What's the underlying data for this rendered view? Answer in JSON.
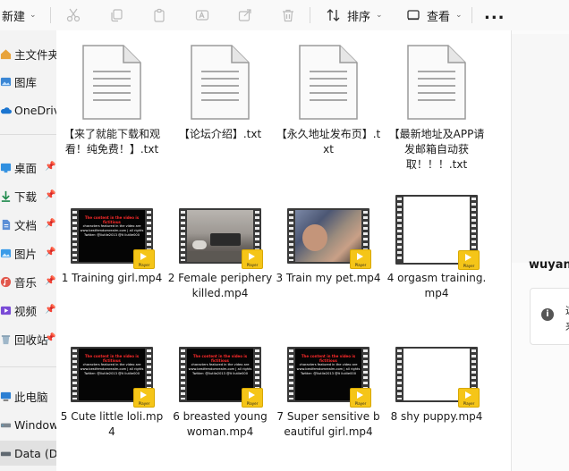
{
  "toolbar": {
    "new_label": "新建",
    "sort_label": "排序",
    "view_label": "查看",
    "more_label": "..."
  },
  "sidebar": {
    "items": [
      {
        "label": "主文件夹",
        "icon": "home-icon"
      },
      {
        "label": "图库",
        "icon": "gallery-icon"
      },
      {
        "label": "OneDrive",
        "icon": "cloud-icon"
      },
      {
        "label": "桌面",
        "icon": "desktop-icon"
      },
      {
        "label": "下载",
        "icon": "download-icon"
      },
      {
        "label": "文档",
        "icon": "document-icon"
      },
      {
        "label": "图片",
        "icon": "picture-icon"
      },
      {
        "label": "音乐",
        "icon": "music-icon"
      },
      {
        "label": "视频",
        "icon": "video-icon"
      },
      {
        "label": "回收站",
        "icon": "recycle-bin-icon"
      },
      {
        "label": "此电脑",
        "icon": "this-pc-icon"
      },
      {
        "label": "Windows",
        "icon": "drive-icon"
      },
      {
        "label": "Data (D:)",
        "icon": "drive-icon"
      }
    ]
  },
  "files": [
    {
      "name": "【来了就能下载和观看！纯免费！】.txt",
      "type": "txt"
    },
    {
      "name": "【论坛介绍】.txt",
      "type": "txt"
    },
    {
      "name": "【永久地址发布页】.txt",
      "type": "txt"
    },
    {
      "name": "【最新地址及APP请发邮箱自动获取！！！.txt",
      "type": "txt"
    },
    {
      "name": "1 Training girl.mp4",
      "type": "video",
      "thumb": "text"
    },
    {
      "name": "2 Female periphery killed.mp4",
      "type": "video",
      "thumb": "room"
    },
    {
      "name": "3 Train my pet.mp4",
      "type": "video",
      "thumb": "blur"
    },
    {
      "name": "4 orgasm training.mp4",
      "type": "video",
      "thumb": "white"
    },
    {
      "name": "5 Cute little loli.mp4",
      "type": "video",
      "thumb": "text"
    },
    {
      "name": "6 breasted young woman.mp4",
      "type": "video",
      "thumb": "text"
    },
    {
      "name": "7 Super sensitive beautiful girl.mp4",
      "type": "video",
      "thumb": "text"
    },
    {
      "name": "8 shy puppy.mp4",
      "type": "video",
      "thumb": "white"
    }
  ],
  "video_thumb_text": {
    "line1": "The content in the video is fictitious",
    "line2": "characters featured in the video are",
    "line3": "www.bestfemdomrealm.com | all rights",
    "line4": "Twitter: @liutlie2013 @lt liutlie000",
    "player_label": "Player"
  },
  "details_pane": {
    "file_name": "wuyan",
    "info_line1": "这",
    "info_line2": "来"
  }
}
